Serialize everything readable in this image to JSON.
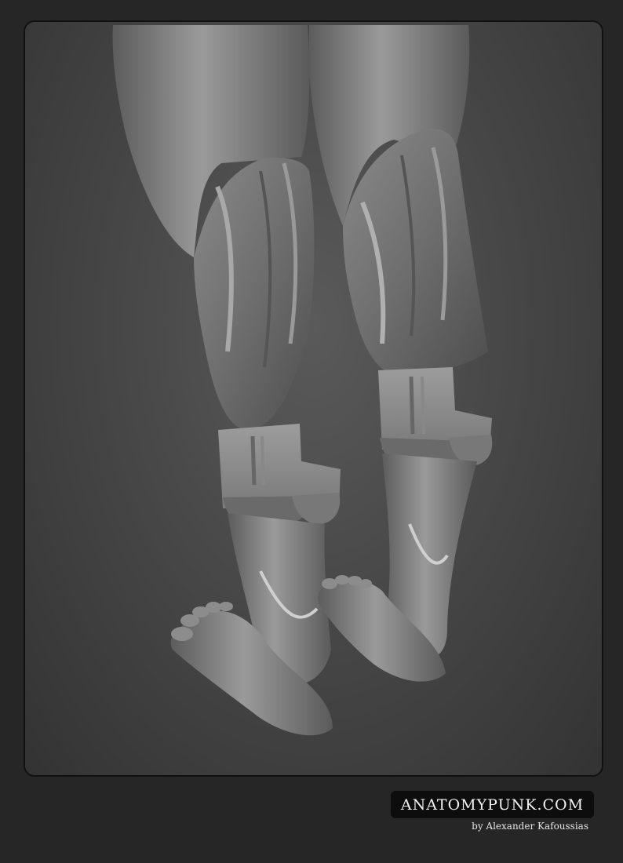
{
  "brand": {
    "site": "ANATOMYPUNK.COM",
    "byline": "by Alexander Kafoussias"
  },
  "colors": {
    "page_background": "#262626",
    "panel_background": "#484848",
    "brand_box": "#0d0d0d",
    "brand_text": "#f2f2f2"
  }
}
